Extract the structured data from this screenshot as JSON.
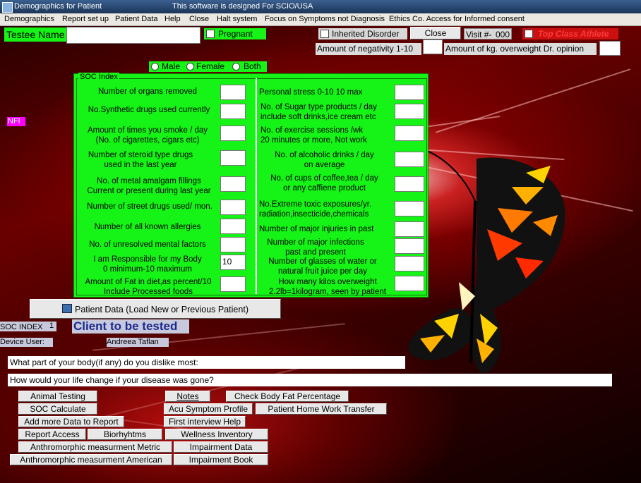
{
  "window": {
    "title": "Demographics for Patient",
    "subtitle": "This software is designed For SCIO/USA"
  },
  "menu": [
    "Demographics",
    "Report set up",
    "Patient Data",
    "Help",
    "Close",
    "Halt system",
    "Focus on Symptoms not Diagnosis",
    "Ethics Co. Access for Informed consent"
  ],
  "header": {
    "testee_label": "Testee Name",
    "testee_value": "",
    "pregnant_label": "Pregnant",
    "inherited_label": "Inherited Disorder",
    "close_label": "Close",
    "visit_label": "Visit #-",
    "visit_value": "000",
    "athlete_label": "Top Class Athlete",
    "negativity_label": "Amount of negativity 1-10",
    "overweight_label": "Amount of kg. overweight Dr. opinion",
    "nfi_label": "NFI"
  },
  "gender": {
    "male": "Male",
    "female": "Female",
    "both": "Both"
  },
  "soc": {
    "legend": "SOC Index",
    "left": [
      {
        "label": "Number of organs removed",
        "value": ""
      },
      {
        "label": "No.Synthetic drugs used currently",
        "value": ""
      },
      {
        "label": "Amount of times you smoke / day\n(No. of cigarettes, cigars etc)",
        "value": ""
      },
      {
        "label": "Number of steroid type drugs\nused in the last year",
        "value": ""
      },
      {
        "label": "No. of metal amalgam fillings\nCurrent or present during last year",
        "value": ""
      },
      {
        "label": "Number of street drugs used/ mon.",
        "value": ""
      },
      {
        "label": "Number of all known allergies",
        "value": ""
      },
      {
        "label": "No. of unresolved mental factors",
        "value": ""
      },
      {
        "label": "I am Responsible for my Body\n0 minimum-10 maximum",
        "value": "10"
      },
      {
        "label": "Amount of Fat in diet,as percent/10\nInclude Processed foods",
        "value": ""
      }
    ],
    "right": [
      {
        "label": "Personal stress 0-10 10 max",
        "value": ""
      },
      {
        "label": "No. of Sugar type products / day\ninclude soft drinks,ice cream etc",
        "value": ""
      },
      {
        "label": "No. of exercise sessions /wk\n20 minutes or more, Not work",
        "value": ""
      },
      {
        "label": "No. of alcoholic drinks / day\non average",
        "value": ""
      },
      {
        "label": "No. of cups of coffee,tea / day\nor any caffiene product",
        "value": ""
      },
      {
        "label": "No.Extreme toxic exposures/yr.\nradiation,insecticide,chemicals",
        "value": ""
      },
      {
        "label": "Number of major injuries in past",
        "value": ""
      },
      {
        "label": "Number of major infections\npast and present",
        "value": ""
      },
      {
        "label": "Number of glasses of water or\nnatural fruit juice per day",
        "value": ""
      },
      {
        "label": "How many kilos overweight\n2.2lb=1kilogram, seen by patient",
        "value": ""
      }
    ]
  },
  "patient_button": "Patient Data (Load New or Previous Patient)",
  "status": {
    "soc_index_label": "SOC INDEX",
    "soc_index_value": "1",
    "client_label": "Client to be tested",
    "device_user_label": "Device User:",
    "device_user_value": "Andreea Taflan"
  },
  "questions": {
    "dislike": "What part of your body(if any) do you dislike most:",
    "life_change": "How would your life change if your disease was gone?"
  },
  "buttons": {
    "animal_testing": "Animal Testing",
    "soc_calculate": "SOC Calculate",
    "add_more": "Add more Data to Report",
    "report_access": "Report Access",
    "biorhythms": "Biorhyhtms",
    "anthro_metric": "Anthromorphic measurment Metric",
    "anthro_american": "Anthromorphic measurment American",
    "notes": "Notes",
    "body_fat": "Check Body Fat Percentage",
    "acu_symptom": "Acu Symptom Profile",
    "home_work": "Patient Home Work Transfer",
    "first_interview": "First interview Help",
    "wellness": "Wellness Inventory",
    "impairment_data": "Impairment Data",
    "impairment_book": "Impairment Book"
  },
  "colors": {
    "panel_green": "#16f316",
    "athlete_red": "#ff2020",
    "nfi_magenta": "#ff00ff",
    "titlebar_blue": "#1b3558"
  },
  "icons": [
    "app-icon",
    "butterfly-image",
    "patient-data-icon"
  ]
}
